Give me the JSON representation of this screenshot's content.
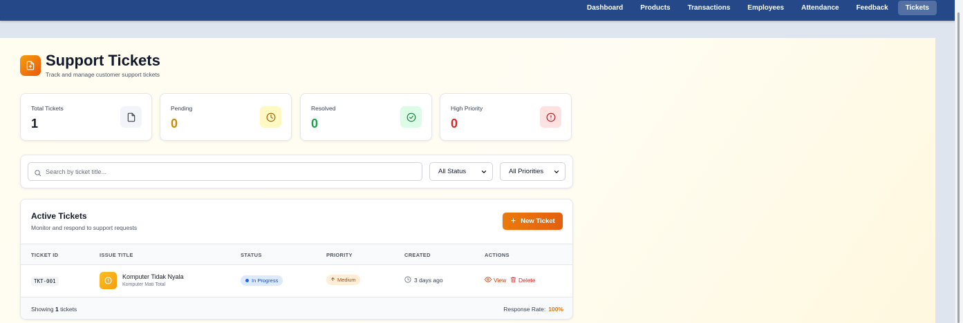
{
  "nav": {
    "items": [
      "Dashboard",
      "Products",
      "Transactions",
      "Employees",
      "Attendance",
      "Feedback",
      "Tickets"
    ],
    "active": "Tickets"
  },
  "header": {
    "title": "Support Tickets",
    "subtitle": "Track and manage customer support tickets",
    "icon": "ticket-document-icon"
  },
  "stats": [
    {
      "label": "Total Tickets",
      "value": "1",
      "color": "#111827",
      "icon": "document-icon",
      "icon_bg": "#f1f5f9",
      "icon_color": "#374151"
    },
    {
      "label": "Pending",
      "value": "0",
      "color": "#ca8a04",
      "icon": "clock-icon",
      "icon_bg": "#fef9c3",
      "icon_color": "#a16207"
    },
    {
      "label": "Resolved",
      "value": "0",
      "color": "#16a34a",
      "icon": "check-circle-icon",
      "icon_bg": "#dcfce7",
      "icon_color": "#15803d"
    },
    {
      "label": "High Priority",
      "value": "0",
      "color": "#dc2626",
      "icon": "alert-circle-icon",
      "icon_bg": "#fee2e2",
      "icon_color": "#b91c1c"
    }
  ],
  "filters": {
    "search_placeholder": "Search by ticket title...",
    "status_value": "All Status",
    "priority_value": "All Priorities"
  },
  "table": {
    "title": "Active Tickets",
    "subtitle": "Monitor and respond to support requests",
    "new_button": "New Ticket",
    "columns": [
      "TICKET ID",
      "ISSUE TITLE",
      "STATUS",
      "PRIORITY",
      "CREATED",
      "ACTIONS"
    ],
    "rows": [
      {
        "id": "TKT-001",
        "title": "Komputer Tidak Nyala",
        "description": "Komputer Mati Total",
        "status": "In Progress",
        "priority": "Medium",
        "created": "3 days ago",
        "view_label": "View",
        "delete_label": "Delete"
      }
    ],
    "footer": {
      "showing_prefix": "Showing",
      "showing_count": "1",
      "showing_suffix": "tickets",
      "response_label": "Response Rate:",
      "response_value": "100%"
    }
  },
  "colors": {
    "topbar": "#254888",
    "accent": "#ea7a0c"
  }
}
